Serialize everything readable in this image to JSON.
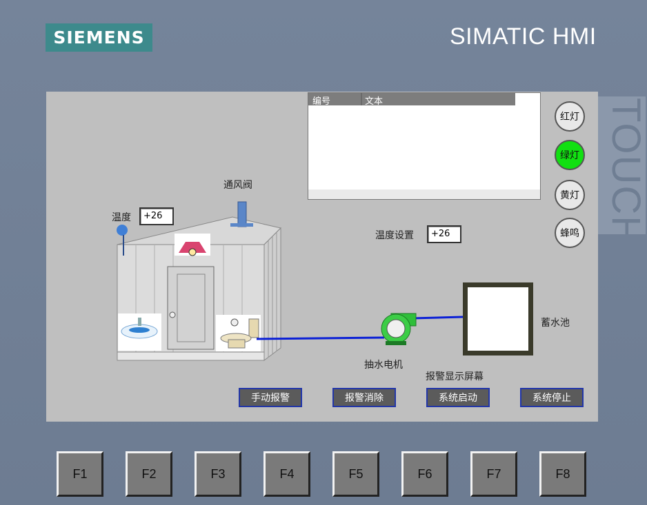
{
  "header": {
    "brand_logo": "SIEMENS",
    "product": "SIMATIC HMI",
    "side_label": "TOUCH"
  },
  "screen": {
    "alarm_view": {
      "col_number": "编号",
      "col_text": "文本",
      "caption": "报警显示屏幕"
    },
    "lamps": [
      {
        "label": "红灯",
        "state": "off",
        "color": "#e8e8e8"
      },
      {
        "label": "绿灯",
        "state": "on",
        "color": "#12e012"
      },
      {
        "label": "黄灯",
        "state": "off",
        "color": "#e8e8e8"
      },
      {
        "label": "蜂鸣",
        "state": "off",
        "color": "#e8e8e8"
      }
    ],
    "temperature_label": "温度",
    "temperature_value": "+26",
    "setpoint_label": "温度设置",
    "setpoint_value": "+26",
    "vent_valve_label": "通风阀",
    "pump_label": "抽水电机",
    "tank_label": "蓄水池",
    "buttons": [
      {
        "label": "手动报警"
      },
      {
        "label": "报警消除"
      },
      {
        "label": "系统启动"
      },
      {
        "label": "系统停止"
      }
    ],
    "pipe_color": "#0a1fd6"
  },
  "function_keys": [
    "F1",
    "F2",
    "F3",
    "F4",
    "F5",
    "F6",
    "F7",
    "F8"
  ]
}
